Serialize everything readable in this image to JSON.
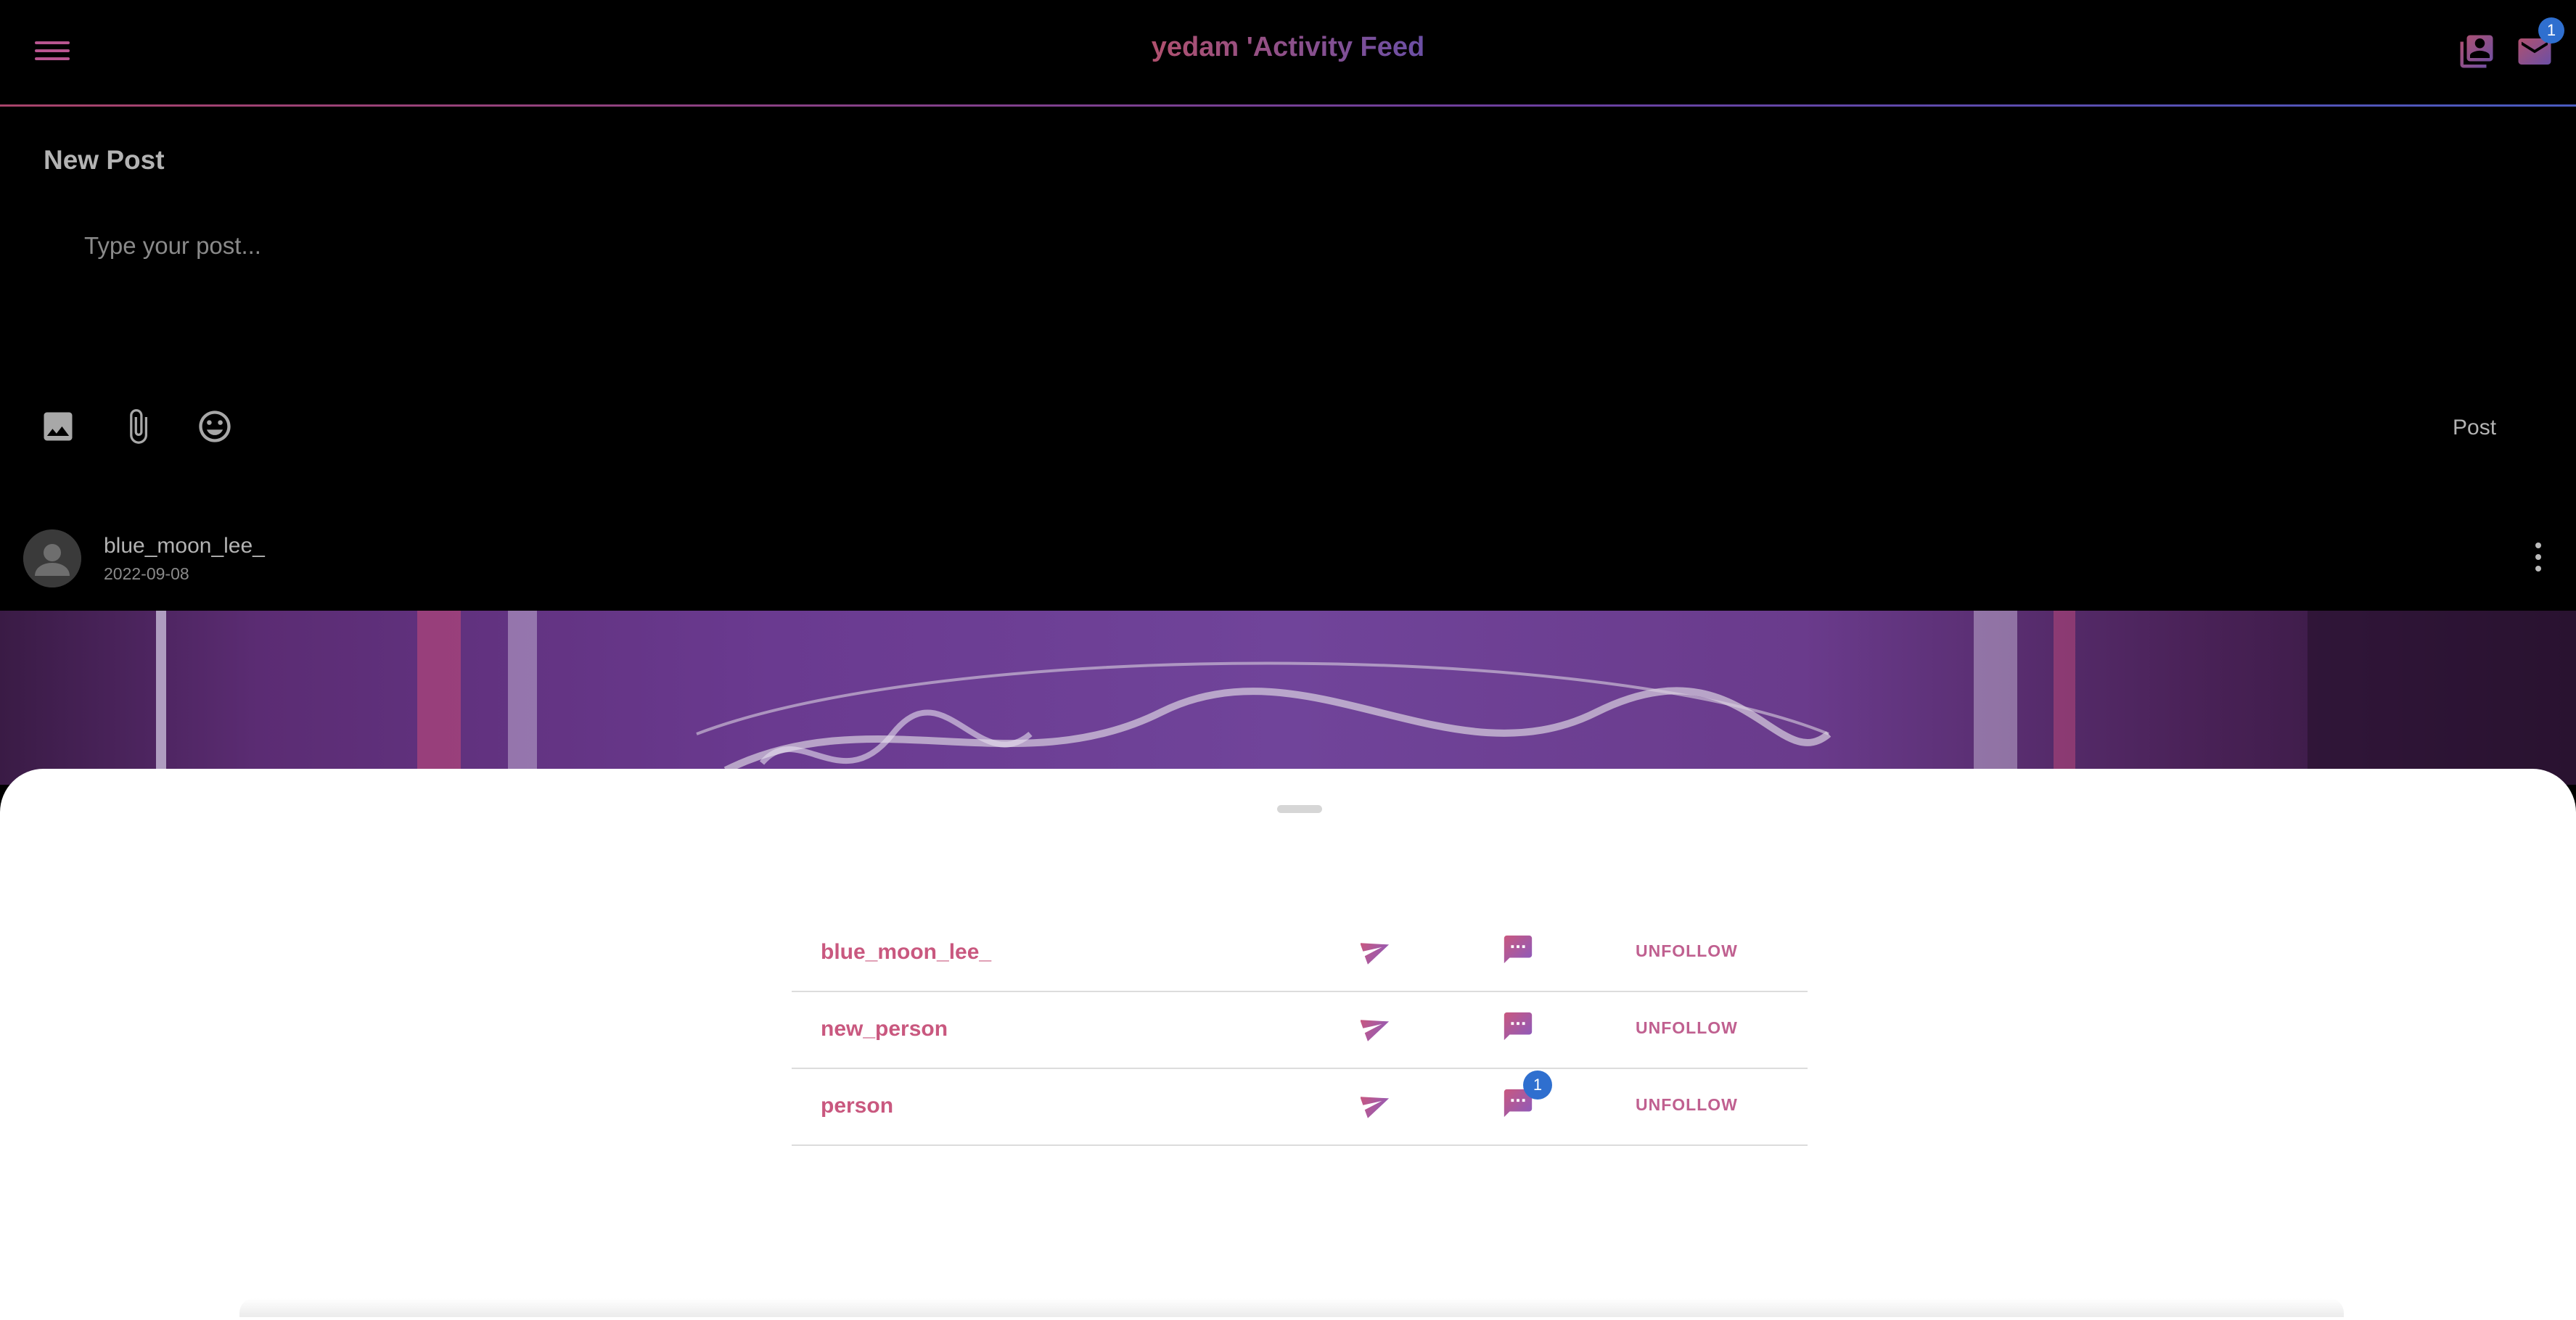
{
  "header": {
    "title": "yedam 'Activity Feed",
    "mail_badge": "1",
    "icons": [
      "menu-icon",
      "library-icon",
      "mail-icon"
    ]
  },
  "composer": {
    "heading": "New Post",
    "placeholder": "Type your post...",
    "post_label": "Post",
    "tools": [
      "image-icon",
      "attachment-icon",
      "emoji-icon"
    ]
  },
  "post": {
    "author": "blue_moon_lee_",
    "date": "2022-09-08"
  },
  "following": {
    "rows": [
      {
        "name": "blue_moon_lee_",
        "action": "UNFOLLOW",
        "unread": ""
      },
      {
        "name": "new_person",
        "action": "UNFOLLOW",
        "unread": ""
      },
      {
        "name": "person",
        "action": "UNFOLLOW",
        "unread": "1"
      }
    ]
  },
  "colors": {
    "accent_pink": "#c9587f",
    "accent_purple": "#8a5bbf",
    "badge_blue": "#2f6fcf",
    "background": "#000000",
    "sheet": "#ffffff"
  }
}
